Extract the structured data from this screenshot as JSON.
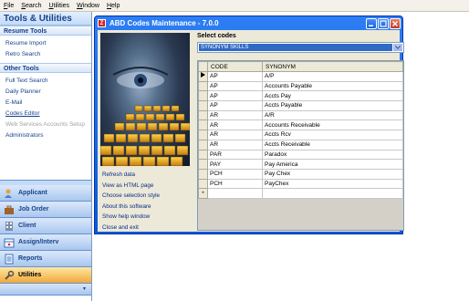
{
  "menu": [
    "File",
    "Search",
    "Utilities",
    "Window",
    "Help"
  ],
  "left": {
    "title": "Tools & Utilities",
    "resume_tools": {
      "header": "Resume Tools",
      "items": [
        "Resume Import",
        "Retro Search"
      ]
    },
    "other_tools": {
      "header": "Other Tools",
      "items": [
        "Full Text Search",
        "Daily Planner",
        "E-Mail",
        "Codes Editor",
        "Web Services Accounts Setup",
        "Administrators"
      ]
    },
    "nav": [
      "Applicant",
      "Job Order",
      "Client",
      "Assign/Interv",
      "Reports",
      "Utilities"
    ],
    "nav_active": "Utilities"
  },
  "dialog": {
    "title": "ABD Codes Maintenance - 7.0.0",
    "app_icon_letter": "Z",
    "select_label": "Select codes",
    "selected_code": "SYNONYM SKILLS",
    "actions": [
      "Refresh data",
      "View as HTML page",
      "Choose selection style",
      "About this software",
      "Show help window",
      "Close and exit"
    ],
    "columns": [
      "CODE",
      "SYNONYM"
    ],
    "rows": [
      [
        "AP",
        "A/P"
      ],
      [
        "AP",
        "Accounts Payable"
      ],
      [
        "AP",
        "Accts Pay"
      ],
      [
        "AP",
        "Accts Payable"
      ],
      [
        "AR",
        "A/R"
      ],
      [
        "AR",
        "Accounts Receivable"
      ],
      [
        "AR",
        "Accts Rcv"
      ],
      [
        "AR",
        "Accts Receivable"
      ],
      [
        "PAR",
        "Paradox"
      ],
      [
        "PAY",
        "Pay America"
      ],
      [
        "PCH",
        "Pay Chex"
      ],
      [
        "PCH",
        "PayChex"
      ]
    ],
    "new_row_marker": "*"
  },
  "colors": {
    "accent": "#15428b",
    "title_blue": "#0a58d8",
    "active_nav": "#f8c86e",
    "selection": "#316ac5"
  }
}
